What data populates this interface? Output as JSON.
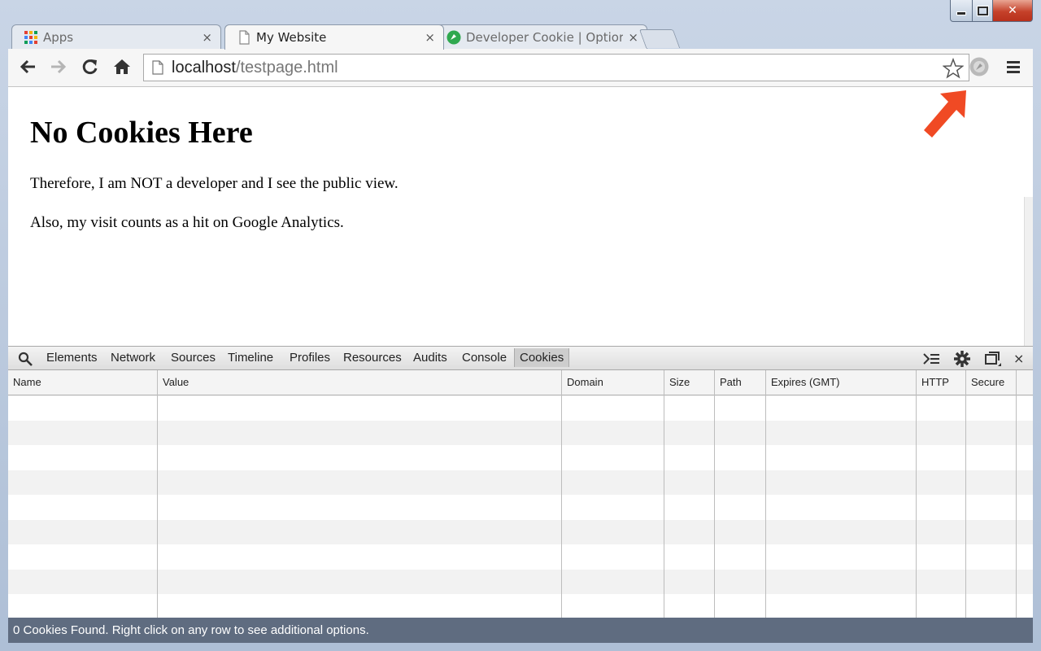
{
  "window": {
    "close_glyph": "✕"
  },
  "tabs": [
    {
      "title": "Apps",
      "close": "×",
      "icon": "apps-grid-icon"
    },
    {
      "title": "My Website",
      "close": "×",
      "icon": "page-icon"
    },
    {
      "title": "Developer Cookie | Optior",
      "close": "×",
      "icon": "extension-icon"
    }
  ],
  "toolbar": {
    "url_host": "localhost",
    "url_path": "/testpage.html"
  },
  "page": {
    "heading": "No Cookies Here",
    "para1": "Therefore, I am NOT a developer and I see the public view.",
    "para2": "Also, my visit counts as a hit on Google Analytics."
  },
  "devtools": {
    "tabs": [
      "Elements",
      "Network",
      "Sources",
      "Timeline",
      "Profiles",
      "Resources",
      "Audits",
      "Console",
      "Cookies"
    ],
    "active_tab": "Cookies",
    "close": "×",
    "columns": [
      "Name",
      "Value",
      "Domain",
      "Size",
      "Path",
      "Expires (GMT)",
      "HTTP",
      "Secure"
    ],
    "status": "0 Cookies Found. Right click on any row to see additional options."
  },
  "colors": {
    "annotation_arrow": "#f04a24",
    "statusbar_bg": "#5f6c80"
  }
}
